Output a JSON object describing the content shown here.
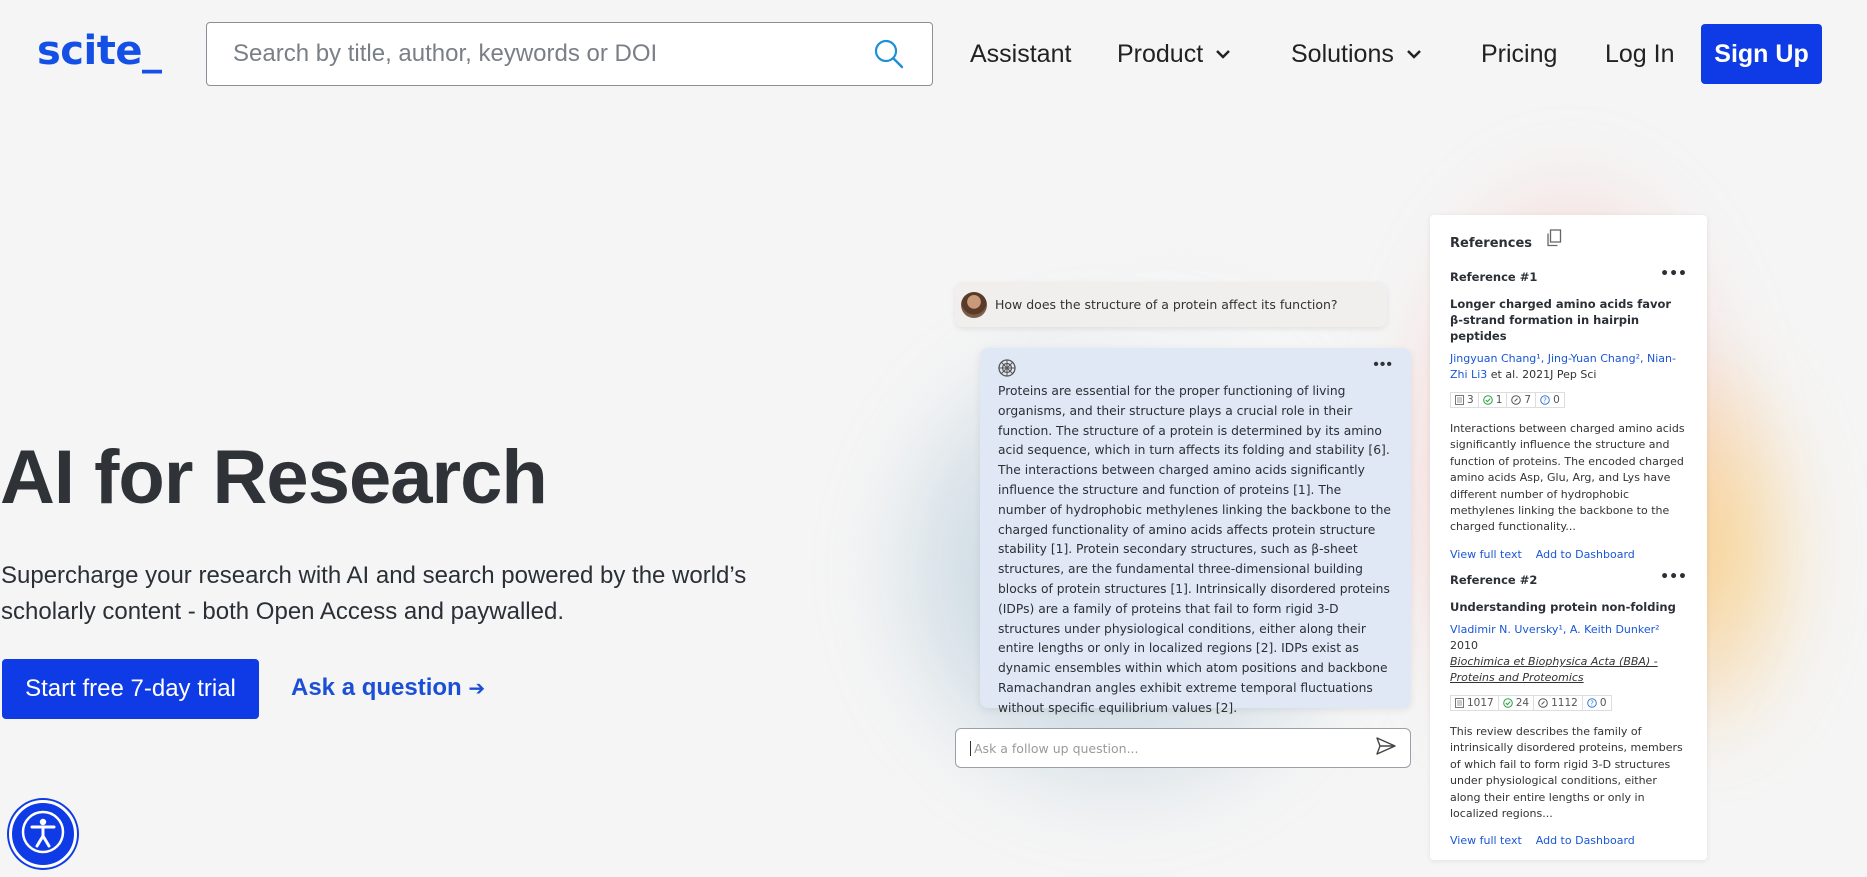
{
  "header": {
    "logo": "scite_",
    "search_placeholder": "Search by title, author, keywords or DOI",
    "nav": {
      "assistant": "Assistant",
      "product": "Product",
      "solutions": "Solutions",
      "pricing": "Pricing",
      "login": "Log In",
      "signup": "Sign Up"
    }
  },
  "hero": {
    "title": "AI for Research",
    "subtitle": "Supercharge your research with AI and search powered by the world’s scholarly content - both Open Access and paywalled.",
    "cta_primary": "Start free 7-day trial",
    "cta_secondary": "Ask a question",
    "cta_secondary_arrow": "➔"
  },
  "chat": {
    "question": "How does the structure of a protein affect its function?",
    "answer": "Proteins are essential for the proper functioning of living organisms, and their structure plays a crucial role in their function. The structure of a protein is determined by its amino acid sequence, which in turn affects its folding and stability [6]. The interactions between charged amino acids significantly influence the structure and function of proteins [1]. The number of hydrophobic methylenes linking the backbone to the charged functionality of amino acids affects protein structure stability [1]. Protein secondary structures, such as β-sheet structures, are the fundamental three-dimensional building blocks of protein structures [1]. Intrinsically disordered proteins (IDPs) are a family of proteins that fail to form rigid 3-D structures under physiological conditions, either along their entire lengths or only in localized regions [2]. IDPs exist as dynamic ensembles within which atom positions and backbone Ramachandran angles exhibit extreme temporal fluctuations without specific equilibrium values [2].",
    "more": "•••",
    "followup_placeholder": "Ask a follow up question..."
  },
  "references": {
    "heading": "References",
    "items": [
      {
        "number": "Reference #1",
        "title": "Longer charged amino acids favor β-strand formation in hairpin peptides",
        "authors_linked": "Jingyuan Chang¹, Jing-Yuan Chang², Nian-Zhi Li3",
        "authors_rest": " et al. 2021J Pep Sci",
        "journal": "",
        "badges": [
          "3",
          "1",
          "7",
          "0"
        ],
        "abstract": "Interactions between charged amino acids significantly influence the structure and function of proteins. The encoded charged amino acids Asp, Glu, Arg, and Lys have different number of hydrophobic methylenes linking the backbone to the charged functionality...",
        "view_full": "View full text",
        "add_dashboard": "Add to Dashboard"
      },
      {
        "number": "Reference #2",
        "title": "Understanding protein non-folding",
        "authors_linked": "Vladimir N. Uversky¹, A. Keith Dunker²",
        "authors_rest": " 2010",
        "journal": "Biochimica et Biophysica Acta (BBA) - Proteins and Proteomics",
        "badges": [
          "1017",
          "24",
          "1112",
          "0"
        ],
        "abstract": "This review describes the family of intrinsically disordered proteins, members of which fail to form rigid 3-D structures under physiological conditions, either along their entire lengths or only in localized regions...",
        "view_full": "View full text",
        "add_dashboard": "Add to Dashboard"
      }
    ]
  },
  "colors": {
    "brand_blue": "#0f3be6",
    "link_blue": "#1a56d6",
    "supported_green": "#2e9e44",
    "contrasting_gray": "#555555",
    "mentioning_blue": "#3a7bd5"
  }
}
